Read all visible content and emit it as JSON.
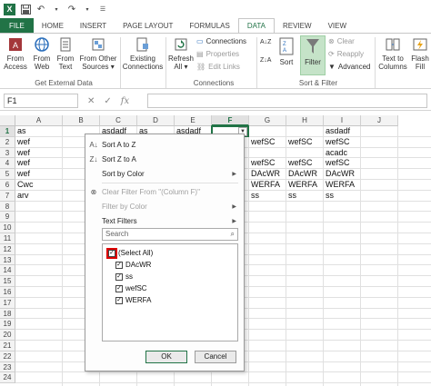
{
  "title_bar": {
    "icons": [
      "excel-logo",
      "save-icon",
      "undo-icon",
      "redo-icon",
      "customize-icon"
    ]
  },
  "tabs": [
    "FILE",
    "HOME",
    "INSERT",
    "PAGE LAYOUT",
    "FORMULAS",
    "DATA",
    "REVIEW",
    "VIEW"
  ],
  "active_tab": "DATA",
  "ribbon": {
    "from_access": "From\nAccess",
    "from_web": "From\nWeb",
    "from_text": "From\nText",
    "from_other": "From Other\nSources ▾",
    "existing": "Existing\nConnections",
    "refresh_all": "Refresh\nAll ▾",
    "connections": "Connections",
    "properties": "Properties",
    "edit_links": "Edit Links",
    "sort_az": "A↓Z",
    "sort_za": "Z↓A",
    "sort": "Sort",
    "filter": "Filter",
    "clear": "Clear",
    "reapply": "Reapply",
    "advanced": "Advanced",
    "text_to_columns": "Text to\nColumns",
    "flash_fill": "Flash\nFill",
    "group_external": "Get External Data",
    "group_connections": "Connections",
    "group_sort": "Sort & Filter"
  },
  "formula_bar": {
    "name_box": "F1",
    "cancel": "✕",
    "enter": "✓",
    "fx": "fx",
    "value": ""
  },
  "columns": [
    "A",
    "B",
    "C",
    "D",
    "E",
    "F",
    "G",
    "H",
    "I",
    "J"
  ],
  "selected_column": "F",
  "rows": [
    "1",
    "2",
    "3",
    "4",
    "5",
    "6",
    "7",
    "8",
    "9",
    "10",
    "11",
    "12",
    "13",
    "14",
    "15",
    "16",
    "17",
    "18",
    "19",
    "20",
    "21",
    "22",
    "23",
    "24"
  ],
  "selected_row": "1",
  "cells": {
    "A1": "as",
    "C1": "asdadf",
    "D1": "as",
    "E1": "asdadf",
    "I1": "asdadf",
    "A2": "wef",
    "G2": "wefSC",
    "H2": "wefSC",
    "I2": "wefSC",
    "A3": "wef",
    "I3": "acadc",
    "A4": "wef",
    "G4": "wefSC",
    "H4": "wefSC",
    "I4": "wefSC",
    "A5": "wef",
    "G5": "DAcWR",
    "H5": "DAcWR",
    "I5": "DAcWR",
    "A6": "Cwc",
    "G6": "WERFA",
    "H6": "WERFA",
    "I6": "WERFA",
    "A7": "arv",
    "G7": "ss",
    "H7": "ss",
    "I7": "ss"
  },
  "filter_menu": {
    "sort_az": "Sort A to Z",
    "sort_za": "Sort Z to A",
    "sort_color": "Sort by Color",
    "clear_filter": "Clear Filter From \"(Column F)\"",
    "filter_color": "Filter by Color",
    "text_filters": "Text Filters",
    "search_placeholder": "Search",
    "items": [
      {
        "label": "(Select All)",
        "checked": true
      },
      {
        "label": "DAcWR",
        "checked": true
      },
      {
        "label": "ss",
        "checked": true
      },
      {
        "label": "wefSC",
        "checked": true
      },
      {
        "label": "WERFA",
        "checked": true
      }
    ],
    "ok": "OK",
    "cancel": "Cancel"
  }
}
